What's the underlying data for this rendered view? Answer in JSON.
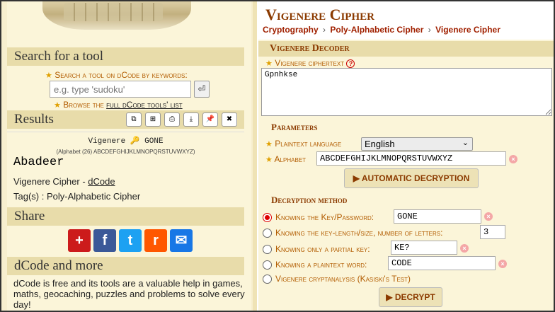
{
  "left": {
    "search": {
      "title": "Search for a tool",
      "label": "Search a tool on dCode by keywords:",
      "placeholder": "e.g. type 'sudoku'",
      "go_label": "⏎",
      "browse_prefix": "Browse the",
      "browse_link": "full dCode tools' list"
    },
    "results": {
      "title": "Results",
      "tools": [
        "⧉",
        "⊞",
        "⎙",
        "⤓",
        "📌",
        "✖"
      ],
      "result_title": "Vigenere 🔑 GONE",
      "alphabet_note": "(Alphabet (26) ABCDEFGHIJKLMNOPQRSTUVWXYZ)",
      "output": "Abadeer",
      "credit_prefix": "Vigenere Cipher - ",
      "credit_link": "dCode",
      "tags": "Tag(s) : Poly-Alphabetic Cipher"
    },
    "share": {
      "title": "Share",
      "buttons": [
        {
          "name": "add",
          "glyph": "+",
          "color": "#cc1b1b"
        },
        {
          "name": "facebook",
          "glyph": "f",
          "color": "#3b5998"
        },
        {
          "name": "twitter",
          "glyph": "t",
          "color": "#1da1f2"
        },
        {
          "name": "reddit",
          "glyph": "r",
          "color": "#ff5700"
        },
        {
          "name": "email",
          "glyph": "✉",
          "color": "#1877e6"
        }
      ]
    },
    "more": {
      "title": "dCode and more",
      "text": "dCode is free and its tools are a valuable help in games, maths, geocaching, puzzles and problems to solve every day!"
    }
  },
  "right": {
    "title": "Vigenere Cipher",
    "breadcrumb": [
      "Cryptography",
      "Poly-Alphabetic Cipher",
      "Vigenere Cipher"
    ],
    "decoder": {
      "title": "Vigenere Decoder",
      "ciphertext_label": "Vigenere ciphertext",
      "ciphertext_value": "Gpnhkse",
      "parameters_title": "Parameters",
      "plaintext_language_label": "Plaintext language",
      "plaintext_language_value": "English",
      "alphabet_label": "Alphabet",
      "alphabet_value": "ABCDEFGHIJKLMNOPQRSTUVWXYZ",
      "auto_button": "▶ AUTOMATIC DECRYPTION",
      "method_title": "Decryption method",
      "methods": [
        {
          "label": "Knowing the Key/Password:",
          "value": "GONE",
          "selected": true
        },
        {
          "label": "Knowing the key-length/size, number of letters:",
          "value": "3",
          "selected": false
        },
        {
          "label": "Knowing only a partial key:",
          "value": "KE?",
          "selected": false
        },
        {
          "label": "Knowing a plaintext word:",
          "value": "CODE",
          "selected": false
        },
        {
          "label": "Vigenere cryptanalysis (Kasiski's Test)",
          "value": "",
          "selected": false
        }
      ],
      "decrypt_button": "▶ DECRYPT"
    }
  }
}
